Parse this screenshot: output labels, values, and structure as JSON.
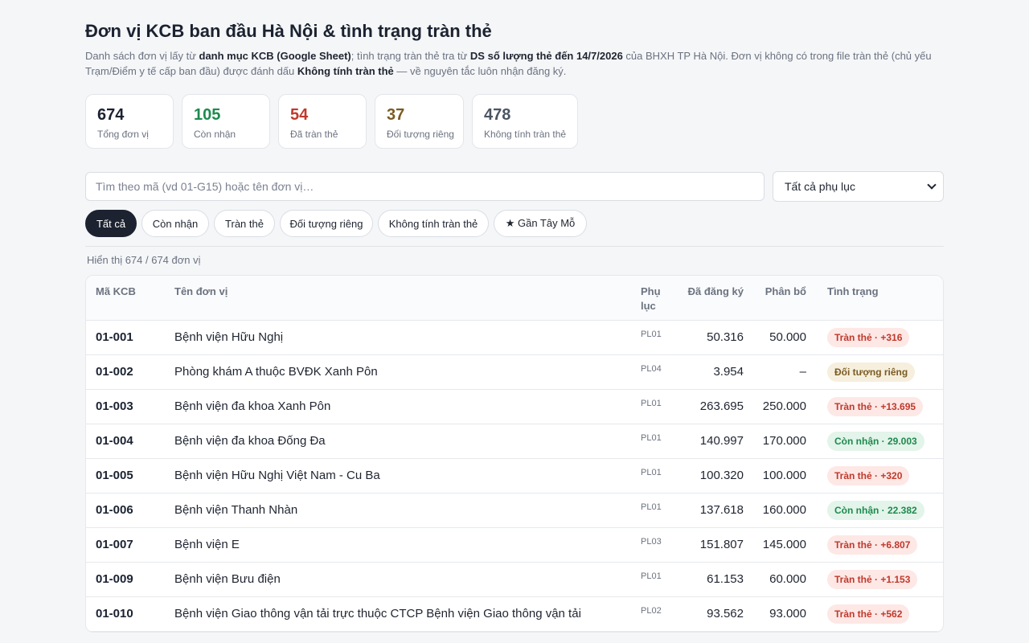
{
  "header": {
    "title": "Đơn vị KCB ban đầu Hà Nội & tình trạng tràn thẻ",
    "desc_1": "Danh sách đơn vị lấy từ ",
    "desc_b1": "danh mục KCB (Google Sheet)",
    "desc_2": "; tình trạng tràn thẻ tra từ ",
    "desc_b2": "DS số lượng thẻ đến 14/7/2026",
    "desc_3": " của BHXH TP Hà Nội. Đơn vị không có trong file tràn thẻ (chủ yếu Trạm/Điểm y tế cấp ban đầu) được đánh dấu ",
    "desc_b3": "Không tính tràn thẻ",
    "desc_4": " — về nguyên tắc luôn nhận đăng ký."
  },
  "stats": [
    {
      "value": "674",
      "label": "Tổng đơn vị",
      "color": "#1b2230"
    },
    {
      "value": "105",
      "label": "Còn nhận",
      "color": "#1e8a4e"
    },
    {
      "value": "54",
      "label": "Đã tràn thẻ",
      "color": "#c0392b"
    },
    {
      "value": "37",
      "label": "Đối tượng riêng",
      "color": "#7a5b22"
    },
    {
      "value": "478",
      "label": "Không tính tràn thẻ",
      "color": "#4b5563"
    }
  ],
  "search": {
    "placeholder": "Tìm theo mã (vd 01-G15) hoặc tên đơn vị…",
    "value": ""
  },
  "filter_select": {
    "selected": "Tất cả phụ lục"
  },
  "chips": [
    {
      "label": "Tất cả",
      "active": true
    },
    {
      "label": "Còn nhận",
      "active": false
    },
    {
      "label": "Tràn thẻ",
      "active": false
    },
    {
      "label": "Đối tượng riêng",
      "active": false
    },
    {
      "label": "Không tính tràn thẻ",
      "active": false
    },
    {
      "label": "★ Gần Tây Mỗ",
      "active": false
    }
  ],
  "count_text": "Hiển thị 674 / 674 đơn vị",
  "table": {
    "headers": {
      "code": "Mã KCB",
      "name": "Tên đơn vị",
      "appendix_1": "Phụ",
      "appendix_2": "lục",
      "registered": "Đã đăng ký",
      "allocated": "Phân bổ",
      "status": "Tình trạng"
    },
    "rows": [
      {
        "code": "01-001",
        "name": "Bệnh viện Hữu Nghị",
        "appendix": "PL01",
        "registered": "50.316",
        "allocated": "50.000",
        "status": "Tràn thẻ · +316",
        "status_type": "over"
      },
      {
        "code": "01-002",
        "name": "Phòng khám A thuộc BVĐK Xanh Pôn",
        "appendix": "PL04",
        "registered": "3.954",
        "allocated": "–",
        "status": "Đối tượng riêng",
        "status_type": "special"
      },
      {
        "code": "01-003",
        "name": "Bệnh viện đa khoa Xanh Pôn",
        "appendix": "PL01",
        "registered": "263.695",
        "allocated": "250.000",
        "status": "Tràn thẻ · +13.695",
        "status_type": "over"
      },
      {
        "code": "01-004",
        "name": "Bệnh viện đa khoa Đống Đa",
        "appendix": "PL01",
        "registered": "140.997",
        "allocated": "170.000",
        "status": "Còn nhận · 29.003",
        "status_type": "ok"
      },
      {
        "code": "01-005",
        "name": "Bệnh viện Hữu Nghị Việt Nam - Cu Ba",
        "appendix": "PL01",
        "registered": "100.320",
        "allocated": "100.000",
        "status": "Tràn thẻ · +320",
        "status_type": "over"
      },
      {
        "code": "01-006",
        "name": "Bệnh viện Thanh Nhàn",
        "appendix": "PL01",
        "registered": "137.618",
        "allocated": "160.000",
        "status": "Còn nhận · 22.382",
        "status_type": "ok"
      },
      {
        "code": "01-007",
        "name": "Bệnh viện E",
        "appendix": "PL03",
        "registered": "151.807",
        "allocated": "145.000",
        "status": "Tràn thẻ · +6.807",
        "status_type": "over"
      },
      {
        "code": "01-009",
        "name": "Bệnh viện Bưu điện",
        "appendix": "PL01",
        "registered": "61.153",
        "allocated": "60.000",
        "status": "Tràn thẻ · +1.153",
        "status_type": "over"
      },
      {
        "code": "01-010",
        "name": "Bệnh viện Giao thông vận tải trực thuộc CTCP Bệnh viện Giao thông vận tải",
        "appendix": "PL02",
        "registered": "93.562",
        "allocated": "93.000",
        "status": "Tràn thẻ · +562",
        "status_type": "over"
      }
    ]
  }
}
